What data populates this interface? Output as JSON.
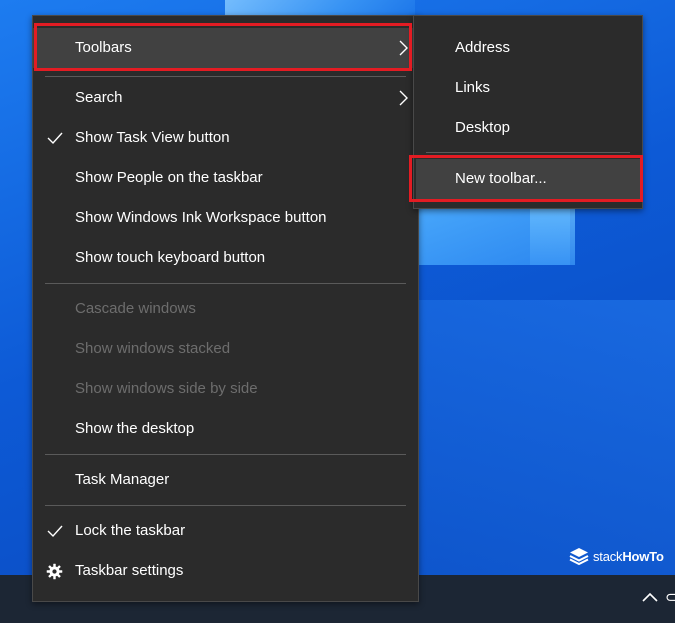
{
  "main_menu": {
    "items": [
      {
        "label": "Toolbars"
      },
      {
        "label": "Search"
      },
      {
        "label": "Show Task View button"
      },
      {
        "label": "Show People on the taskbar"
      },
      {
        "label": "Show Windows Ink Workspace button"
      },
      {
        "label": "Show touch keyboard button"
      },
      {
        "label": "Cascade windows"
      },
      {
        "label": "Show windows stacked"
      },
      {
        "label": "Show windows side by side"
      },
      {
        "label": "Show the desktop"
      },
      {
        "label": "Task Manager"
      },
      {
        "label": "Lock the taskbar"
      },
      {
        "label": "Taskbar settings"
      }
    ]
  },
  "sub_menu": {
    "items": [
      {
        "label": "Address"
      },
      {
        "label": "Links"
      },
      {
        "label": "Desktop"
      },
      {
        "label": "New toolbar..."
      }
    ]
  },
  "watermark": {
    "part1": "stack",
    "part2": "HowTo"
  },
  "colors": {
    "menu_bg": "#2b2b2b",
    "menu_hover": "#414141",
    "disabled_text": "#6d6d6d",
    "highlight_border": "#e31c23",
    "taskbar": "#1c2634"
  },
  "icons": {
    "checkmark": "checkmark-icon",
    "submenu_arrow": "chevron-right-icon",
    "settings": "gear-icon",
    "tray": "chevron-up-icon",
    "brand": "stack-layers-icon"
  }
}
